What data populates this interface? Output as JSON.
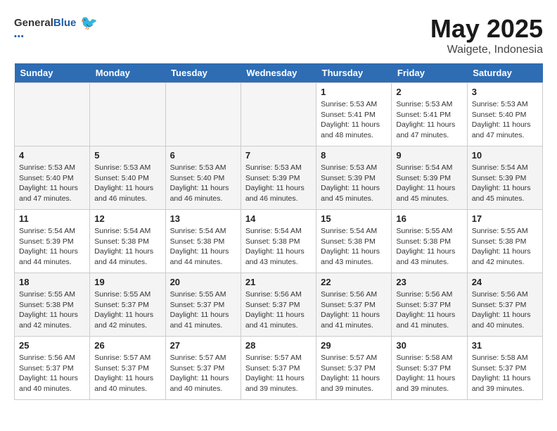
{
  "header": {
    "logo_general": "General",
    "logo_blue": "Blue",
    "month": "May 2025",
    "location": "Waigete, Indonesia"
  },
  "days_of_week": [
    "Sunday",
    "Monday",
    "Tuesday",
    "Wednesday",
    "Thursday",
    "Friday",
    "Saturday"
  ],
  "weeks": [
    [
      {
        "num": "",
        "sunrise": "",
        "sunset": "",
        "daylight": "",
        "empty": true
      },
      {
        "num": "",
        "sunrise": "",
        "sunset": "",
        "daylight": "",
        "empty": true
      },
      {
        "num": "",
        "sunrise": "",
        "sunset": "",
        "daylight": "",
        "empty": true
      },
      {
        "num": "",
        "sunrise": "",
        "sunset": "",
        "daylight": "",
        "empty": true
      },
      {
        "num": "1",
        "sunrise": "Sunrise: 5:53 AM",
        "sunset": "Sunset: 5:41 PM",
        "daylight": "Daylight: 11 hours and 48 minutes.",
        "empty": false
      },
      {
        "num": "2",
        "sunrise": "Sunrise: 5:53 AM",
        "sunset": "Sunset: 5:41 PM",
        "daylight": "Daylight: 11 hours and 47 minutes.",
        "empty": false
      },
      {
        "num": "3",
        "sunrise": "Sunrise: 5:53 AM",
        "sunset": "Sunset: 5:40 PM",
        "daylight": "Daylight: 11 hours and 47 minutes.",
        "empty": false
      }
    ],
    [
      {
        "num": "4",
        "sunrise": "Sunrise: 5:53 AM",
        "sunset": "Sunset: 5:40 PM",
        "daylight": "Daylight: 11 hours and 47 minutes.",
        "empty": false
      },
      {
        "num": "5",
        "sunrise": "Sunrise: 5:53 AM",
        "sunset": "Sunset: 5:40 PM",
        "daylight": "Daylight: 11 hours and 46 minutes.",
        "empty": false
      },
      {
        "num": "6",
        "sunrise": "Sunrise: 5:53 AM",
        "sunset": "Sunset: 5:40 PM",
        "daylight": "Daylight: 11 hours and 46 minutes.",
        "empty": false
      },
      {
        "num": "7",
        "sunrise": "Sunrise: 5:53 AM",
        "sunset": "Sunset: 5:39 PM",
        "daylight": "Daylight: 11 hours and 46 minutes.",
        "empty": false
      },
      {
        "num": "8",
        "sunrise": "Sunrise: 5:53 AM",
        "sunset": "Sunset: 5:39 PM",
        "daylight": "Daylight: 11 hours and 45 minutes.",
        "empty": false
      },
      {
        "num": "9",
        "sunrise": "Sunrise: 5:54 AM",
        "sunset": "Sunset: 5:39 PM",
        "daylight": "Daylight: 11 hours and 45 minutes.",
        "empty": false
      },
      {
        "num": "10",
        "sunrise": "Sunrise: 5:54 AM",
        "sunset": "Sunset: 5:39 PM",
        "daylight": "Daylight: 11 hours and 45 minutes.",
        "empty": false
      }
    ],
    [
      {
        "num": "11",
        "sunrise": "Sunrise: 5:54 AM",
        "sunset": "Sunset: 5:39 PM",
        "daylight": "Daylight: 11 hours and 44 minutes.",
        "empty": false
      },
      {
        "num": "12",
        "sunrise": "Sunrise: 5:54 AM",
        "sunset": "Sunset: 5:38 PM",
        "daylight": "Daylight: 11 hours and 44 minutes.",
        "empty": false
      },
      {
        "num": "13",
        "sunrise": "Sunrise: 5:54 AM",
        "sunset": "Sunset: 5:38 PM",
        "daylight": "Daylight: 11 hours and 44 minutes.",
        "empty": false
      },
      {
        "num": "14",
        "sunrise": "Sunrise: 5:54 AM",
        "sunset": "Sunset: 5:38 PM",
        "daylight": "Daylight: 11 hours and 43 minutes.",
        "empty": false
      },
      {
        "num": "15",
        "sunrise": "Sunrise: 5:54 AM",
        "sunset": "Sunset: 5:38 PM",
        "daylight": "Daylight: 11 hours and 43 minutes.",
        "empty": false
      },
      {
        "num": "16",
        "sunrise": "Sunrise: 5:55 AM",
        "sunset": "Sunset: 5:38 PM",
        "daylight": "Daylight: 11 hours and 43 minutes.",
        "empty": false
      },
      {
        "num": "17",
        "sunrise": "Sunrise: 5:55 AM",
        "sunset": "Sunset: 5:38 PM",
        "daylight": "Daylight: 11 hours and 42 minutes.",
        "empty": false
      }
    ],
    [
      {
        "num": "18",
        "sunrise": "Sunrise: 5:55 AM",
        "sunset": "Sunset: 5:38 PM",
        "daylight": "Daylight: 11 hours and 42 minutes.",
        "empty": false
      },
      {
        "num": "19",
        "sunrise": "Sunrise: 5:55 AM",
        "sunset": "Sunset: 5:37 PM",
        "daylight": "Daylight: 11 hours and 42 minutes.",
        "empty": false
      },
      {
        "num": "20",
        "sunrise": "Sunrise: 5:55 AM",
        "sunset": "Sunset: 5:37 PM",
        "daylight": "Daylight: 11 hours and 41 minutes.",
        "empty": false
      },
      {
        "num": "21",
        "sunrise": "Sunrise: 5:56 AM",
        "sunset": "Sunset: 5:37 PM",
        "daylight": "Daylight: 11 hours and 41 minutes.",
        "empty": false
      },
      {
        "num": "22",
        "sunrise": "Sunrise: 5:56 AM",
        "sunset": "Sunset: 5:37 PM",
        "daylight": "Daylight: 11 hours and 41 minutes.",
        "empty": false
      },
      {
        "num": "23",
        "sunrise": "Sunrise: 5:56 AM",
        "sunset": "Sunset: 5:37 PM",
        "daylight": "Daylight: 11 hours and 41 minutes.",
        "empty": false
      },
      {
        "num": "24",
        "sunrise": "Sunrise: 5:56 AM",
        "sunset": "Sunset: 5:37 PM",
        "daylight": "Daylight: 11 hours and 40 minutes.",
        "empty": false
      }
    ],
    [
      {
        "num": "25",
        "sunrise": "Sunrise: 5:56 AM",
        "sunset": "Sunset: 5:37 PM",
        "daylight": "Daylight: 11 hours and 40 minutes.",
        "empty": false
      },
      {
        "num": "26",
        "sunrise": "Sunrise: 5:57 AM",
        "sunset": "Sunset: 5:37 PM",
        "daylight": "Daylight: 11 hours and 40 minutes.",
        "empty": false
      },
      {
        "num": "27",
        "sunrise": "Sunrise: 5:57 AM",
        "sunset": "Sunset: 5:37 PM",
        "daylight": "Daylight: 11 hours and 40 minutes.",
        "empty": false
      },
      {
        "num": "28",
        "sunrise": "Sunrise: 5:57 AM",
        "sunset": "Sunset: 5:37 PM",
        "daylight": "Daylight: 11 hours and 39 minutes.",
        "empty": false
      },
      {
        "num": "29",
        "sunrise": "Sunrise: 5:57 AM",
        "sunset": "Sunset: 5:37 PM",
        "daylight": "Daylight: 11 hours and 39 minutes.",
        "empty": false
      },
      {
        "num": "30",
        "sunrise": "Sunrise: 5:58 AM",
        "sunset": "Sunset: 5:37 PM",
        "daylight": "Daylight: 11 hours and 39 minutes.",
        "empty": false
      },
      {
        "num": "31",
        "sunrise": "Sunrise: 5:58 AM",
        "sunset": "Sunset: 5:37 PM",
        "daylight": "Daylight: 11 hours and 39 minutes.",
        "empty": false
      }
    ]
  ]
}
